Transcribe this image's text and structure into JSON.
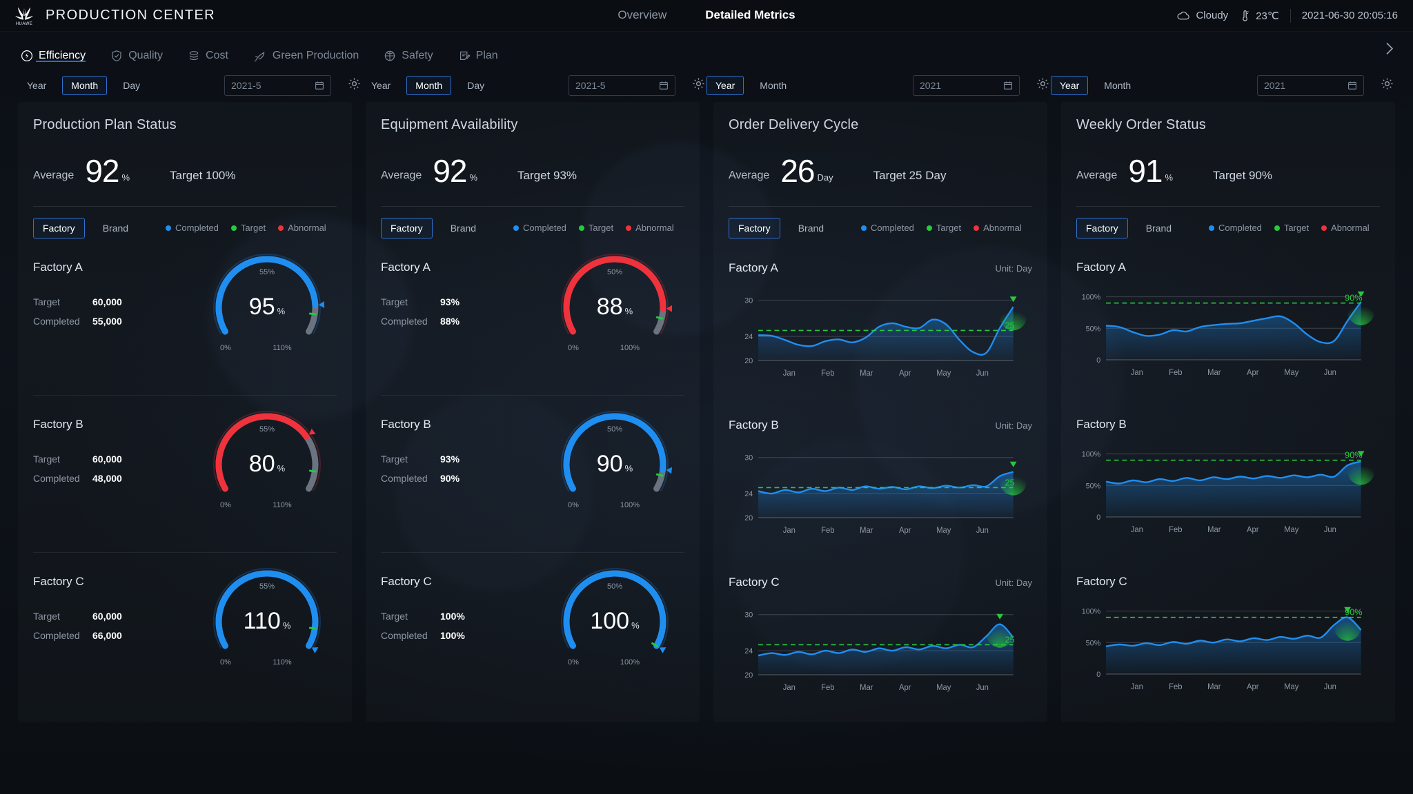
{
  "header": {
    "brand": "HUAWE",
    "title": "PRODUCTION CENTER",
    "nav": [
      {
        "label": "Overview",
        "active": false
      },
      {
        "label": "Detailed Metrics",
        "active": true
      }
    ],
    "weather_icon": "cloud-icon",
    "weather": "Cloudy",
    "temp_icon": "thermometer-icon",
    "temperature": "23℃",
    "datetime": "2021-06-30 20:05:16"
  },
  "tabs": [
    {
      "label": "Efficiency",
      "icon": "speedometer-icon",
      "active": true
    },
    {
      "label": "Quality",
      "icon": "shield-check-icon",
      "active": false
    },
    {
      "label": "Cost",
      "icon": "coins-icon",
      "active": false
    },
    {
      "label": "Green Production",
      "icon": "leaf-icon",
      "active": false
    },
    {
      "label": "Safety",
      "icon": "helmet-icon",
      "active": false
    },
    {
      "label": "Plan",
      "icon": "clipboard-edit-icon",
      "active": false
    }
  ],
  "tabs_next_icon": "chevron-right-icon",
  "filters": [
    {
      "options": [
        "Year",
        "Month",
        "Day"
      ],
      "selected": "Month",
      "date": "2021‑5",
      "calendar_icon": "calendar-icon",
      "gear_icon": "gear-icon"
    },
    {
      "options": [
        "Year",
        "Month",
        "Day"
      ],
      "selected": "Month",
      "date": "2021‑5",
      "calendar_icon": "calendar-icon",
      "gear_icon": "gear-icon"
    },
    {
      "options": [
        "Year",
        "Month"
      ],
      "selected": "Year",
      "date": "2021",
      "calendar_icon": "calendar-icon",
      "gear_icon": "gear-icon"
    },
    {
      "options": [
        "Year",
        "Month"
      ],
      "selected": "Year",
      "date": "2021",
      "calendar_icon": "calendar-icon",
      "gear_icon": "gear-icon"
    }
  ],
  "colors": {
    "blue": "#1f8ef1",
    "red": "#f0323c",
    "green": "#27c93f",
    "track": "#6b7280",
    "accent": "#2f6fd0"
  },
  "legend": [
    {
      "label": "Completed",
      "color": "#1f8ef1"
    },
    {
      "label": "Target",
      "color": "#27c93f"
    },
    {
      "label": "Abnormal",
      "color": "#f0323c"
    }
  ],
  "grouping": {
    "options": [
      "Factory",
      "Brand"
    ],
    "selected": "Factory"
  },
  "cards": [
    {
      "title": "Production Plan Status",
      "average_label": "Average",
      "average_value": "92",
      "average_unit": "%",
      "target_label": "Target 100%",
      "type": "gauge",
      "rows": [
        {
          "name": "Factory A",
          "kv": [
            {
              "k": "Target",
              "v": "60,000"
            },
            {
              "k": "Completed",
              "v": "55,000"
            }
          ],
          "gauge": {
            "value": "95",
            "unit": "%",
            "mid_label": "55%",
            "min_label": "0%",
            "max_label": "110%",
            "percent": 95,
            "max": 110,
            "color": "#1f8ef1",
            "target_percent": 100,
            "marker": "down"
          }
        },
        {
          "name": "Factory B",
          "kv": [
            {
              "k": "Target",
              "v": "60,000"
            },
            {
              "k": "Completed",
              "v": "48,000"
            }
          ],
          "gauge": {
            "value": "80",
            "unit": "%",
            "mid_label": "55%",
            "min_label": "0%",
            "max_label": "110%",
            "percent": 80,
            "max": 110,
            "color": "#f0323c",
            "target_percent": 100,
            "marker": "up"
          }
        },
        {
          "name": "Factory C",
          "kv": [
            {
              "k": "Target",
              "v": "60,000"
            },
            {
              "k": "Completed",
              "v": "66,000"
            }
          ],
          "gauge": {
            "value": "110",
            "unit": "%",
            "mid_label": "55%",
            "min_label": "0%",
            "max_label": "110%",
            "percent": 110,
            "max": 110,
            "color": "#1f8ef1",
            "target_percent": 100,
            "marker": "down"
          }
        }
      ]
    },
    {
      "title": "Equipment Availability",
      "average_label": "Average",
      "average_value": "92",
      "average_unit": "%",
      "target_label": "Target 93%",
      "type": "gauge",
      "rows": [
        {
          "name": "Factory A",
          "kv": [
            {
              "k": "Target",
              "v": "93%"
            },
            {
              "k": "Completed",
              "v": "88%"
            }
          ],
          "gauge": {
            "value": "88",
            "unit": "%",
            "mid_label": "50%",
            "min_label": "0%",
            "max_label": "100%",
            "percent": 88,
            "max": 100,
            "color": "#f0323c",
            "target_percent": 93,
            "marker": "left"
          }
        },
        {
          "name": "Factory B",
          "kv": [
            {
              "k": "Target",
              "v": "93%"
            },
            {
              "k": "Completed",
              "v": "90%"
            }
          ],
          "gauge": {
            "value": "90",
            "unit": "%",
            "mid_label": "50%",
            "min_label": "0%",
            "max_label": "100%",
            "percent": 90,
            "max": 100,
            "color": "#1f8ef1",
            "target_percent": 93,
            "marker": "right"
          }
        },
        {
          "name": "Factory C",
          "kv": [
            {
              "k": "Target",
              "v": "100%"
            },
            {
              "k": "Completed",
              "v": "100%"
            }
          ],
          "gauge": {
            "value": "100",
            "unit": "%",
            "mid_label": "50%",
            "min_label": "0%",
            "max_label": "100%",
            "percent": 100,
            "max": 100,
            "color": "#1f8ef1",
            "target_percent": 100,
            "marker": "down"
          }
        }
      ]
    },
    {
      "title": "Order Delivery Cycle",
      "average_label": "Average",
      "average_value": "26",
      "average_unit": "Day",
      "target_label": "Target 25 Day",
      "type": "chart",
      "rows": [
        {
          "name": "Factory A",
          "unit": "Unit: Day"
        },
        {
          "name": "Factory B",
          "unit": "Unit: Day"
        },
        {
          "name": "Factory C",
          "unit": "Unit: Day"
        }
      ]
    },
    {
      "title": "Weekly Order Status",
      "average_label": "Average",
      "average_value": "91",
      "average_unit": "%",
      "target_label": "Target 90%",
      "type": "chart",
      "rows": [
        {
          "name": "Factory A",
          "unit": ""
        },
        {
          "name": "Factory B",
          "unit": ""
        },
        {
          "name": "Factory C",
          "unit": ""
        }
      ]
    }
  ],
  "chart_data": [
    {
      "type": "area",
      "title": "Order Delivery Cycle – Factory A",
      "xlabel": "",
      "ylabel": "Day",
      "categories": [
        "Jan",
        "Feb",
        "Mar",
        "Apr",
        "May",
        "Jun"
      ],
      "yticks": [
        20,
        24,
        30
      ],
      "ylim": [
        20,
        31
      ],
      "target": 25,
      "target_label": "25",
      "grid": true,
      "legend": "none",
      "x": [
        0,
        1,
        2,
        3,
        4,
        5,
        6,
        7,
        8,
        9,
        10,
        11,
        12,
        13,
        14,
        15,
        16,
        17,
        18,
        19
      ],
      "values": [
        24.2,
        24.1,
        23.4,
        22.6,
        22.4,
        23.2,
        23.5,
        23.0,
        23.8,
        25.6,
        26.2,
        25.6,
        25.4,
        26.8,
        26.0,
        23.4,
        21.4,
        21.3,
        25.4,
        28.9
      ]
    },
    {
      "type": "area",
      "title": "Order Delivery Cycle – Factory B",
      "xlabel": "",
      "ylabel": "Day",
      "categories": [
        "Jan",
        "Feb",
        "Mar",
        "Apr",
        "May",
        "Jun"
      ],
      "yticks": [
        20,
        24,
        30
      ],
      "ylim": [
        20,
        31
      ],
      "target": 25,
      "target_label": "25",
      "grid": true,
      "legend": "none",
      "x": [
        0,
        1,
        2,
        3,
        4,
        5,
        6,
        7,
        8,
        9,
        10,
        11,
        12,
        13,
        14,
        15,
        16,
        17,
        18,
        19
      ],
      "values": [
        24.4,
        24.0,
        24.6,
        24.2,
        24.8,
        24.4,
        25.0,
        24.6,
        25.2,
        24.8,
        25.1,
        24.7,
        25.2,
        24.9,
        25.3,
        25.0,
        25.4,
        25.2,
        26.9,
        27.6
      ]
    },
    {
      "type": "area",
      "title": "Order Delivery Cycle – Factory C",
      "xlabel": "",
      "ylabel": "Day",
      "categories": [
        "Jan",
        "Feb",
        "Mar",
        "Apr",
        "May",
        "Jun"
      ],
      "yticks": [
        20,
        24,
        30
      ],
      "ylim": [
        20,
        31
      ],
      "target": 25,
      "target_label": "25",
      "grid": true,
      "legend": "none",
      "x": [
        0,
        1,
        2,
        3,
        4,
        5,
        6,
        7,
        8,
        9,
        10,
        11,
        12,
        13,
        14,
        15,
        16,
        17,
        18,
        19
      ],
      "values": [
        23.2,
        23.6,
        23.3,
        23.8,
        23.4,
        24.0,
        23.6,
        24.2,
        23.8,
        24.4,
        24.0,
        24.6,
        24.2,
        24.8,
        24.4,
        25.0,
        24.6,
        26.4,
        28.4,
        26.2
      ]
    },
    {
      "type": "area",
      "title": "Weekly Order Status – Factory A",
      "xlabel": "",
      "ylabel": "%",
      "categories": [
        "Jan",
        "Feb",
        "Mar",
        "Apr",
        "May",
        "Jun"
      ],
      "yticks": [
        0,
        50,
        100
      ],
      "ytick_labels": [
        "0",
        "50%",
        "100%"
      ],
      "ylim": [
        0,
        105
      ],
      "target": 90,
      "target_label": "90%",
      "grid": true,
      "legend": "none",
      "x": [
        0,
        1,
        2,
        3,
        4,
        5,
        6,
        7,
        8,
        9,
        10,
        11,
        12,
        13,
        14,
        15,
        16,
        17,
        18,
        19
      ],
      "values": [
        54,
        52,
        44,
        38,
        40,
        47,
        45,
        52,
        55,
        57,
        58,
        62,
        66,
        69,
        58,
        40,
        28,
        30,
        62,
        92
      ]
    },
    {
      "type": "area",
      "title": "Weekly Order Status – Factory B",
      "xlabel": "",
      "ylabel": "%",
      "categories": [
        "Jan",
        "Feb",
        "Mar",
        "Apr",
        "May",
        "Jun"
      ],
      "yticks": [
        0,
        50,
        100
      ],
      "ytick_labels": [
        "0",
        "50%",
        "100%"
      ],
      "ylim": [
        0,
        105
      ],
      "target": 90,
      "target_label": "90%",
      "grid": true,
      "legend": "none",
      "x": [
        0,
        1,
        2,
        3,
        4,
        5,
        6,
        7,
        8,
        9,
        10,
        11,
        12,
        13,
        14,
        15,
        16,
        17,
        18,
        19
      ],
      "values": [
        56,
        53,
        58,
        55,
        60,
        57,
        62,
        58,
        63,
        60,
        64,
        61,
        65,
        62,
        66,
        63,
        67,
        64,
        82,
        88
      ]
    },
    {
      "type": "area",
      "title": "Weekly Order Status – Factory C",
      "xlabel": "",
      "ylabel": "%",
      "categories": [
        "Jan",
        "Feb",
        "Mar",
        "Apr",
        "May",
        "Jun"
      ],
      "yticks": [
        0,
        50,
        100
      ],
      "ytick_labels": [
        "0",
        "50%",
        "100%"
      ],
      "ylim": [
        0,
        105
      ],
      "target": 90,
      "target_label": "90%",
      "grid": true,
      "legend": "none",
      "x": [
        0,
        1,
        2,
        3,
        4,
        5,
        6,
        7,
        8,
        9,
        10,
        11,
        12,
        13,
        14,
        15,
        16,
        17,
        18,
        19
      ],
      "values": [
        44,
        47,
        45,
        49,
        46,
        51,
        48,
        53,
        50,
        55,
        52,
        57,
        54,
        59,
        56,
        61,
        58,
        78,
        90,
        70
      ]
    }
  ]
}
